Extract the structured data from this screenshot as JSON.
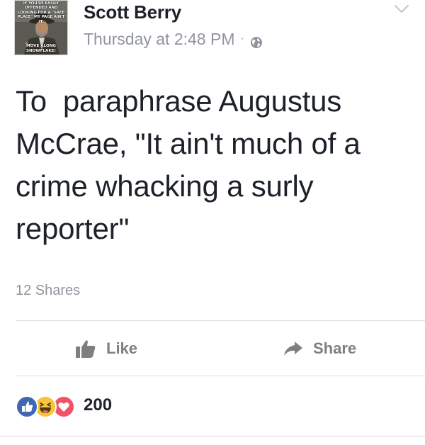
{
  "post": {
    "author": "Scott Berry",
    "timestamp": "Thursday at 2:48 PM",
    "separator": "·",
    "privacy_icon": "globe-icon",
    "text": "To  paraphrase Augustus McCrae, \"It ain't much of a crime whacking a surly reporter\"",
    "shares": "12 Shares",
    "reaction_count": "200",
    "reactions": [
      "like",
      "haha",
      "love"
    ]
  },
  "avatar": {
    "meme_top": "IF YOU'RE EASILY OFFENDED AND LOOKING FOR A \"SAFE PLACE\" MY PAGE AIN'T IT.",
    "meme_bottom": "MOVE ALONG SNOWFLAKE!"
  },
  "actions": {
    "like_label": "Like",
    "share_label": "Share"
  },
  "colors": {
    "text": "#1d2129",
    "meta": "#90949c",
    "action": "#7f7f7f",
    "divider": "#dadde1",
    "like_blue": "#4267b2",
    "haha_yellow": "#f7c33b",
    "love_red": "#f25268"
  }
}
